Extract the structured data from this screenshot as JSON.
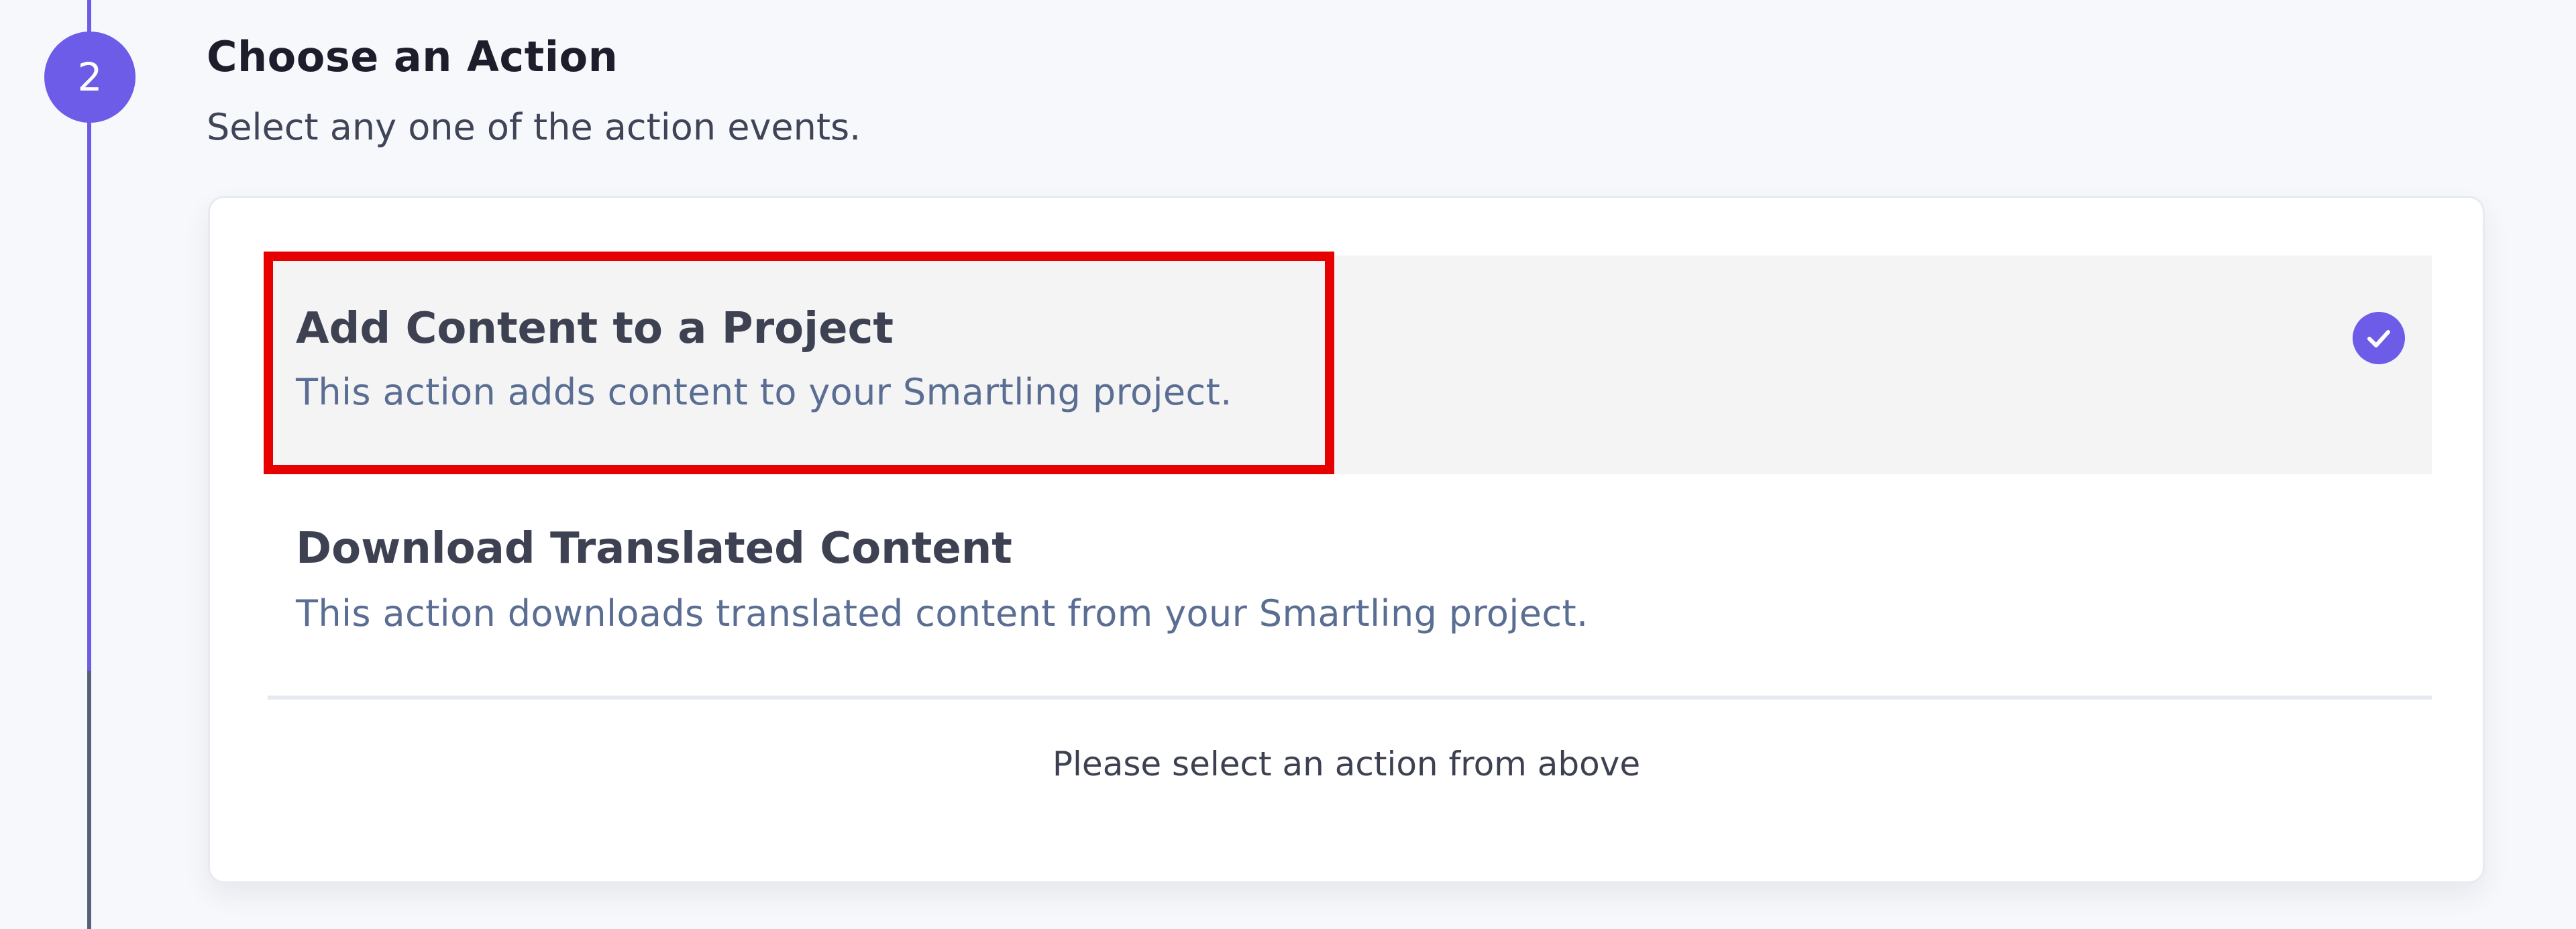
{
  "step": {
    "number": "2",
    "title": "Choose an Action",
    "subtitle": "Select any one of the action events."
  },
  "options": [
    {
      "title": "Add Content to a Project",
      "description": "This action adds content to your Smartling project.",
      "selected": true
    },
    {
      "title": "Download Translated Content",
      "description": "This action downloads translated content from your Smartling project.",
      "selected": false
    }
  ],
  "hint": "Please select an action from above",
  "colors": {
    "accent": "#6c5ce7",
    "highlight": "#e70000",
    "selected_background": "#f4f4f5"
  },
  "icons": {
    "selected_indicator": "check-circle-icon"
  }
}
